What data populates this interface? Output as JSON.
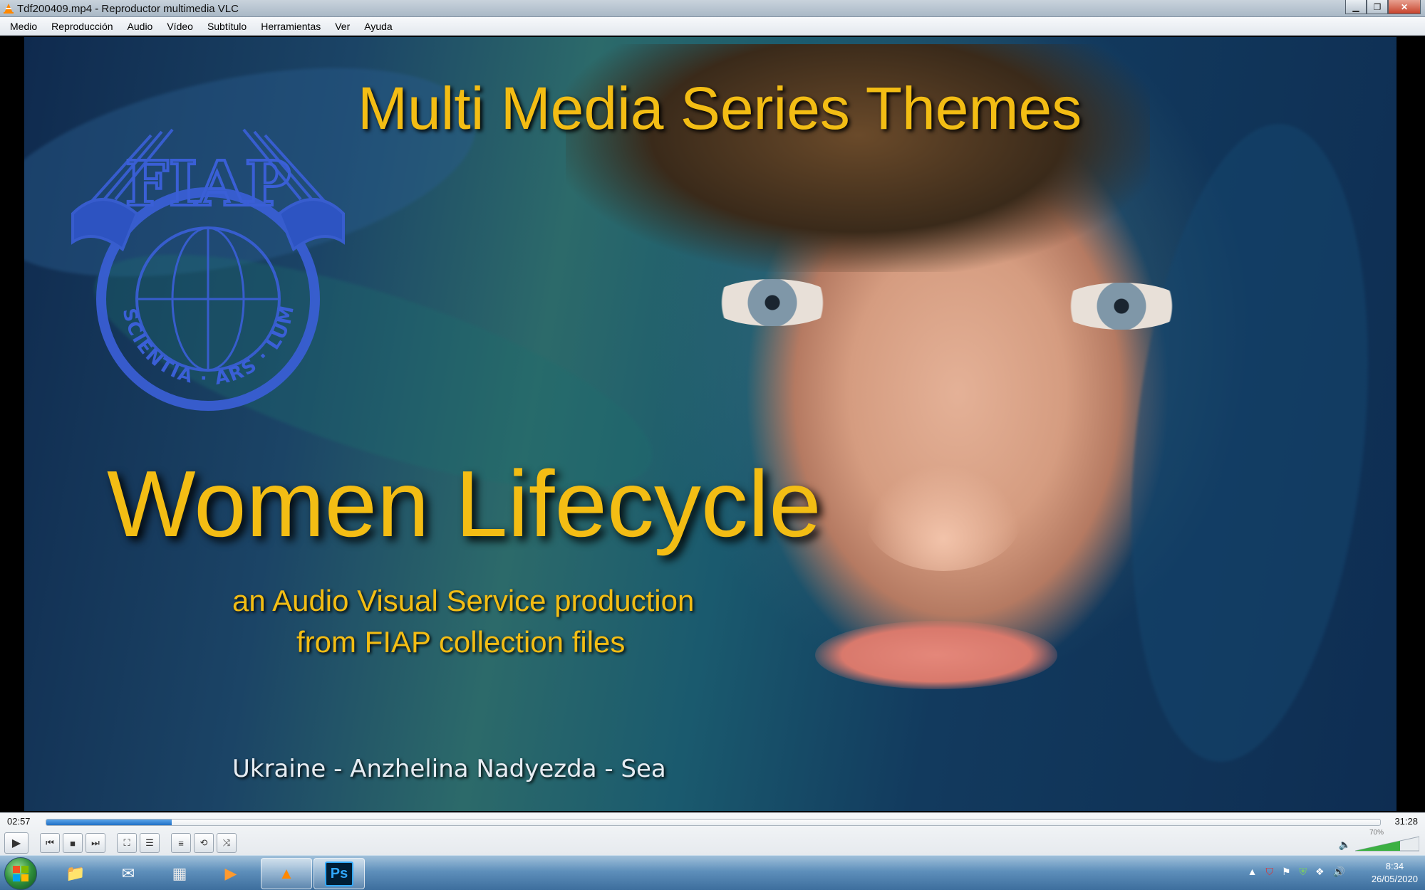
{
  "window": {
    "title": "Tdf200409.mp4 - Reproductor multimedia VLC"
  },
  "menu": [
    "Medio",
    "Reproducción",
    "Audio",
    "Vídeo",
    "Subtítulo",
    "Herramientas",
    "Ver",
    "Ayuda"
  ],
  "video": {
    "headline": "Multi Media Series Themes",
    "title": "Women Lifecycle",
    "subtitle_line1": "an Audio Visual Service production",
    "subtitle_line2": "from FIAP collection files",
    "credit": "Ukraine - Anzhelina Nadyezda - Sea",
    "logo_top": "FIAP",
    "logo_ring": "SCIENTIA · ARS · LUMEN",
    "accent_color": "#f3bd14"
  },
  "playback": {
    "elapsed": "02:57",
    "total": "31:28",
    "progress_percent": 9.4,
    "volume_label": "70%",
    "volume_level": 0.7
  },
  "controls": [
    {
      "name": "play-button",
      "icon": "play-icon",
      "glyph": "▶"
    },
    {
      "name": "previous-button",
      "icon": "previous-icon",
      "glyph": "⏮"
    },
    {
      "name": "stop-button",
      "icon": "stop-icon",
      "glyph": "■"
    },
    {
      "name": "next-button",
      "icon": "next-icon",
      "glyph": "⏭"
    },
    {
      "name": "fullscreen-button",
      "icon": "fullscreen-icon",
      "glyph": "⛶"
    },
    {
      "name": "extended-settings-button",
      "icon": "equalizer-icon",
      "glyph": "☰"
    },
    {
      "name": "playlist-button",
      "icon": "playlist-icon",
      "glyph": "≡"
    },
    {
      "name": "loop-button",
      "icon": "loop-icon",
      "glyph": "⟲"
    },
    {
      "name": "shuffle-button",
      "icon": "shuffle-icon",
      "glyph": "⤨"
    }
  ],
  "taskbar": {
    "apps": [
      {
        "name": "explorer",
        "icon": "folder-icon",
        "glyph": "📁"
      },
      {
        "name": "mail",
        "icon": "mail-icon",
        "glyph": "✉"
      },
      {
        "name": "calculator",
        "icon": "calculator-icon",
        "glyph": "▦"
      },
      {
        "name": "media-player",
        "icon": "media-icon",
        "glyph": "▶"
      },
      {
        "name": "vlc",
        "icon": "vlc-cone-icon",
        "glyph": "▲"
      },
      {
        "name": "photoshop",
        "icon": "photoshop-icon",
        "glyph": "Ps"
      }
    ],
    "time": "8:34",
    "date": "26/05/2020"
  }
}
